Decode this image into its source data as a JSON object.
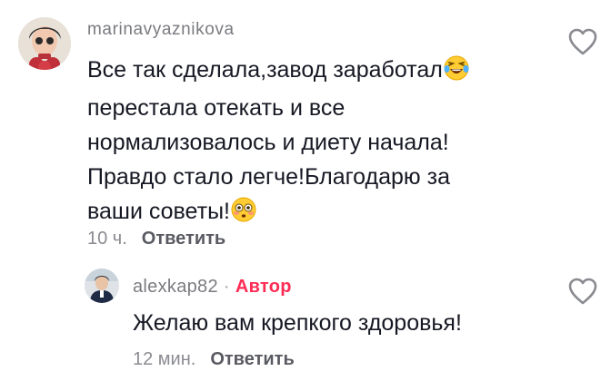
{
  "comments": [
    {
      "username": "marinavyaznikova",
      "text_lines": [
        "Все так сделала,завод заработал",
        "перестала отекать и все",
        "нормализовалось и диету начала!",
        "Правдо стало легче!Благодарю за",
        "ваши советы!"
      ],
      "emoji_1": "laughing-tears",
      "emoji_2": "flushed-face",
      "time": "10 ч.",
      "reply_label": "Ответить"
    },
    {
      "username": "alexkap82",
      "badge": "Автор",
      "separator": "·",
      "text": "Желаю вам крепкого здоровья!",
      "time": "12 мин.",
      "reply_label": "Ответить"
    }
  ],
  "colors": {
    "accent": "#fe2c55",
    "username": "#7a7b80",
    "text": "#161823",
    "meta": "#8a8b91"
  }
}
